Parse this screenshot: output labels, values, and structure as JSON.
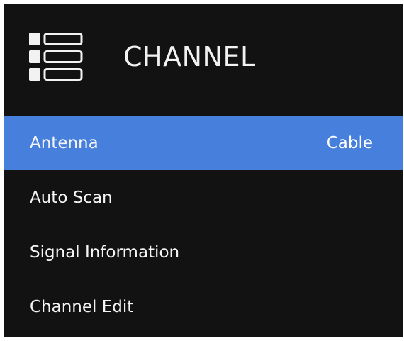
{
  "header": {
    "icon": "channel-list-icon",
    "title": "CHANNEL"
  },
  "menu": {
    "items": [
      {
        "label": "Antenna",
        "value": "Cable",
        "selected": true
      },
      {
        "label": "Auto Scan",
        "value": "",
        "selected": false
      },
      {
        "label": "Signal Information",
        "value": "",
        "selected": false
      },
      {
        "label": "Channel Edit",
        "value": "",
        "selected": false
      }
    ]
  },
  "colors": {
    "background": "#131212",
    "selected": "#4680dc",
    "text": "#f5f5f5"
  }
}
